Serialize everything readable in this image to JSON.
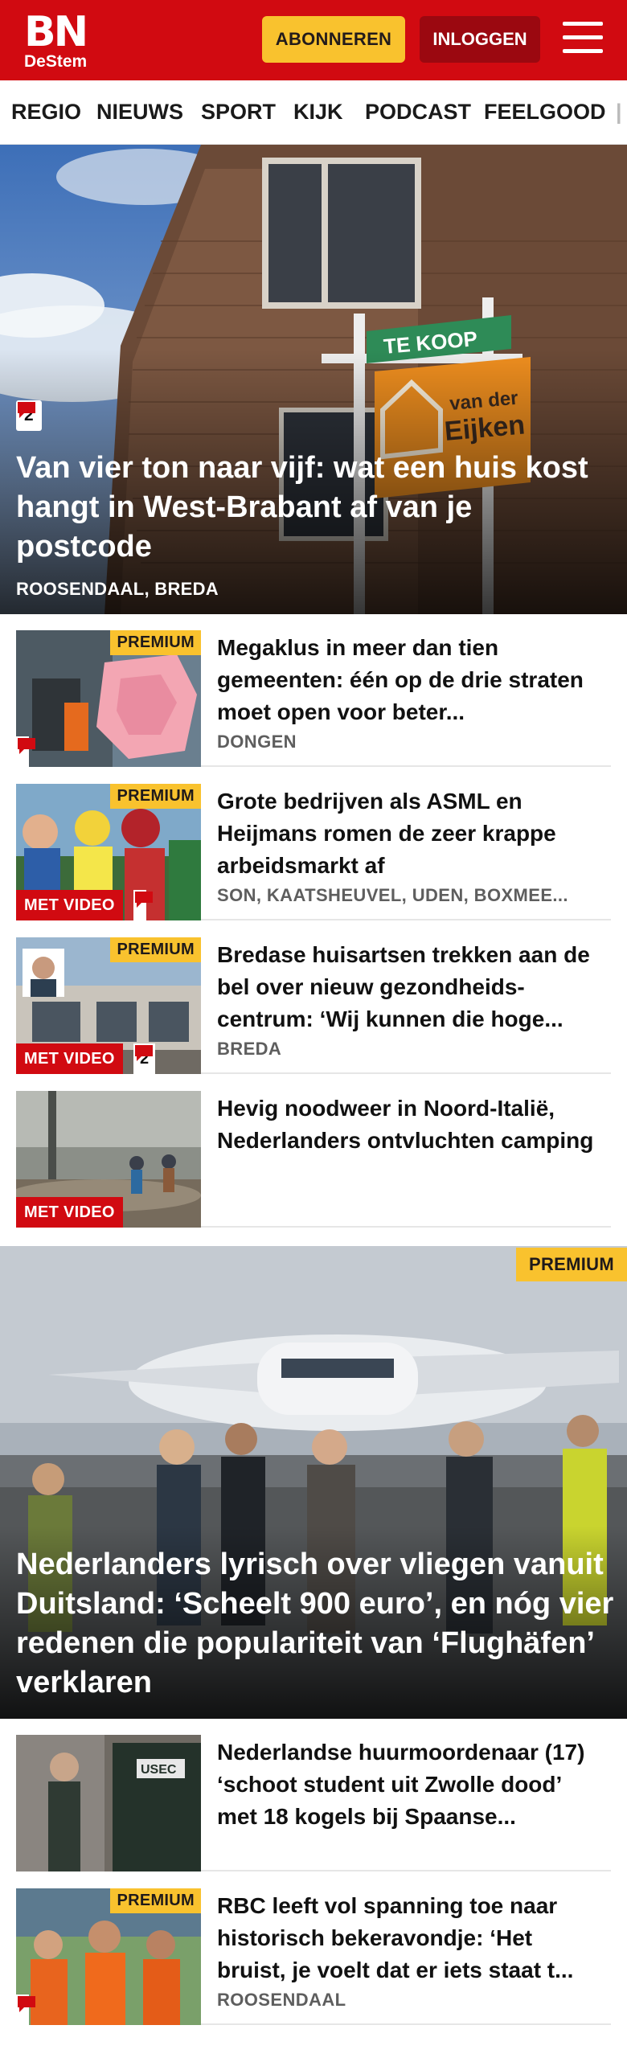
{
  "header": {
    "logo_main": "BN",
    "logo_sub": "DeStem",
    "subscribe_label": "ABONNEREN",
    "login_label": "INLOGGEN"
  },
  "nav": {
    "items": [
      "REGIO",
      "NIEUWS",
      "SPORT",
      "KIJK",
      "PODCAST",
      "FEELGOOD"
    ]
  },
  "hero": {
    "comment_count": "2",
    "title": "Van vier ton naar vijf: wat een huis kost hangt in West-Brabant af van je postcode",
    "tag": "ROOSENDAAL, BREDA",
    "sign_text": "TE KOOP",
    "sign_brand": "van der Eijken"
  },
  "articles": [
    {
      "title": "Megaklus in meer dan tien gemeenten: één op de drie straten moet open voor beter...",
      "tag": "DONGEN",
      "premium": "PREMIUM",
      "video": "",
      "comments": ""
    },
    {
      "title": "Grote bedrijven als ASML en Heijmans romen de zeer krappe arbeidsmarkt af",
      "tag": "SON, KAATSHEUVEL, UDEN, BOXMEE...",
      "premium": "PREMIUM",
      "video": "MET VIDEO",
      "comments": ""
    },
    {
      "title": "Bredase huisartsen trekken aan de bel over nieuw gezondheids-centrum: ‘Wij kunnen die hoge...",
      "tag": "BREDA",
      "premium": "PREMIUM",
      "video": "MET VIDEO",
      "comments": "2"
    },
    {
      "title": "Hevig noodweer in Noord-Italië, Nederlanders ontvluchten camping",
      "tag": "",
      "premium": "",
      "video": "MET VIDEO",
      "comments": ""
    }
  ],
  "feature": {
    "premium": "PREMIUM",
    "title": "Nederlanders lyrisch over vliegen vanuit Duitsland: ‘Scheelt 900 euro’, en nóg vier redenen die populariteit van ‘Flughäfen’ verklaren"
  },
  "articles2": [
    {
      "title": "Nederlandse huurmoordenaar (17) ‘schoot student uit Zwolle dood’ met 18 kogels bij Spaanse...",
      "tag": "",
      "premium": "",
      "video": "",
      "comments": ""
    },
    {
      "title": "RBC leeft vol spanning toe naar historisch bekeravondje: ‘Het bruist, je voelt dat er iets staat t...",
      "tag": "ROOSENDAAL",
      "premium": "PREMIUM",
      "video": "",
      "comments": ""
    }
  ],
  "colors": {
    "brand_red": "#d10a11",
    "login_red": "#9b0810",
    "premium_yellow": "#f9c22e"
  },
  "icons": [
    "menu-icon",
    "comment-icon"
  ]
}
